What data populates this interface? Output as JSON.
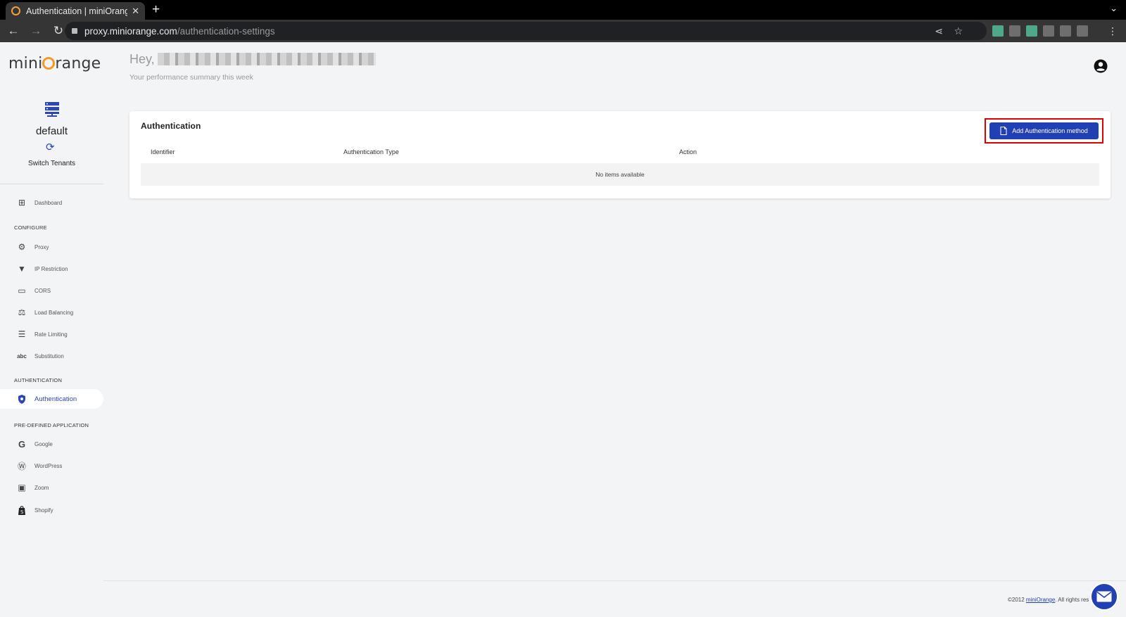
{
  "browser": {
    "tab_title": "Authentication | miniOrange",
    "close": "✕",
    "new_tab": "+",
    "url_host": "proxy.miniorange.com",
    "url_path": "/authentication-settings"
  },
  "brand": {
    "logo_pre": "mini",
    "logo_post": "range"
  },
  "tenant": {
    "name": "default",
    "switch_label": "Switch Tenants"
  },
  "sidebar": {
    "dashboard": "Dashboard",
    "section_configure": "CONFIGURE",
    "proxy": "Proxy",
    "ip_restriction": "IP Restriction",
    "cors": "CORS",
    "load_balancing": "Load Balancing",
    "rate_limiting": "Rate Limiting",
    "substitution": "Substitution",
    "section_authentication": "AUTHENTICATION",
    "authentication": "Authentication",
    "section_predefined": "PRE-DEFINED APPLICATION",
    "google": "Google",
    "wordpress": "WordPress",
    "zoom": "Zoom",
    "shopify": "Shopify"
  },
  "header": {
    "greeting": "Hey,",
    "subtitle": "Your performance summary this week"
  },
  "auth_card": {
    "title": "Authentication",
    "add_button": "Add Authentication method",
    "columns": [
      "Identifier",
      "Authentication Type",
      "Action"
    ],
    "empty_text": "No items available"
  },
  "footer": {
    "copyright_pre": "©2012 ",
    "link": "miniOrange",
    "copyright_post": ". All rights res"
  },
  "colors": {
    "accent": "#2140b4",
    "highlight_frame": "#e10000",
    "logo_orange": "#f39a2a"
  }
}
